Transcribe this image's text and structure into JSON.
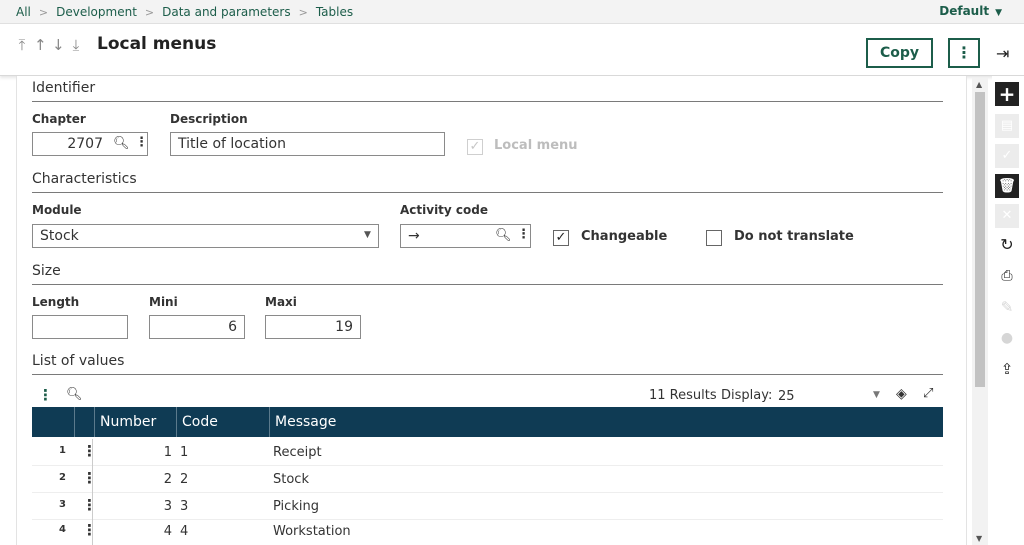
{
  "breadcrumb": [
    "All",
    "Development",
    "Data and parameters",
    "Tables"
  ],
  "profile": "Default",
  "header": {
    "title": "Local menus",
    "copy_label": "Copy",
    "more_label": "⋮"
  },
  "sections": {
    "identifier": "Identifier",
    "characteristics": "Characteristics",
    "size": "Size",
    "list_of_values": "List of values"
  },
  "identifier": {
    "chapter_label": "Chapter",
    "chapter_value": "2707",
    "description_label": "Description",
    "description_value": "Title of location",
    "local_menu_label": "Local menu",
    "local_menu_checked": true
  },
  "characteristics": {
    "module_label": "Module",
    "module_value": "Stock",
    "activity_label": "Activity code",
    "activity_value": "→",
    "changeable_label": "Changeable",
    "changeable_checked": true,
    "do_not_translate_label": "Do not translate",
    "do_not_translate_checked": false
  },
  "size": {
    "length_label": "Length",
    "length_value": "",
    "mini_label": "Mini",
    "mini_value": "6",
    "maxi_label": "Maxi",
    "maxi_value": "19"
  },
  "grid": {
    "results_text": "11 Results",
    "display_label": "Display:",
    "display_value": "25",
    "columns": [
      "Number",
      "Code",
      "Message"
    ],
    "rows": [
      {
        "row": "1",
        "number": "1",
        "code": "1",
        "message": "Receipt"
      },
      {
        "row": "2",
        "number": "2",
        "code": "2",
        "message": "Stock"
      },
      {
        "row": "3",
        "number": "3",
        "code": "3",
        "message": "Picking"
      },
      {
        "row": "4",
        "number": "4",
        "code": "4",
        "message": "Workstation"
      }
    ]
  },
  "icons": {
    "nav": [
      "first-record-icon",
      "previous-record-icon",
      "next-record-icon",
      "last-record-icon"
    ],
    "rail": [
      "add-icon",
      "save-icon",
      "confirm-icon",
      "delete-icon",
      "cancel-icon",
      "refresh-icon",
      "print-icon",
      "attachment-icon",
      "comment-icon",
      "export-icon"
    ]
  },
  "colors": {
    "accent": "#1c5d4a",
    "grid_header": "#0f3b54"
  }
}
